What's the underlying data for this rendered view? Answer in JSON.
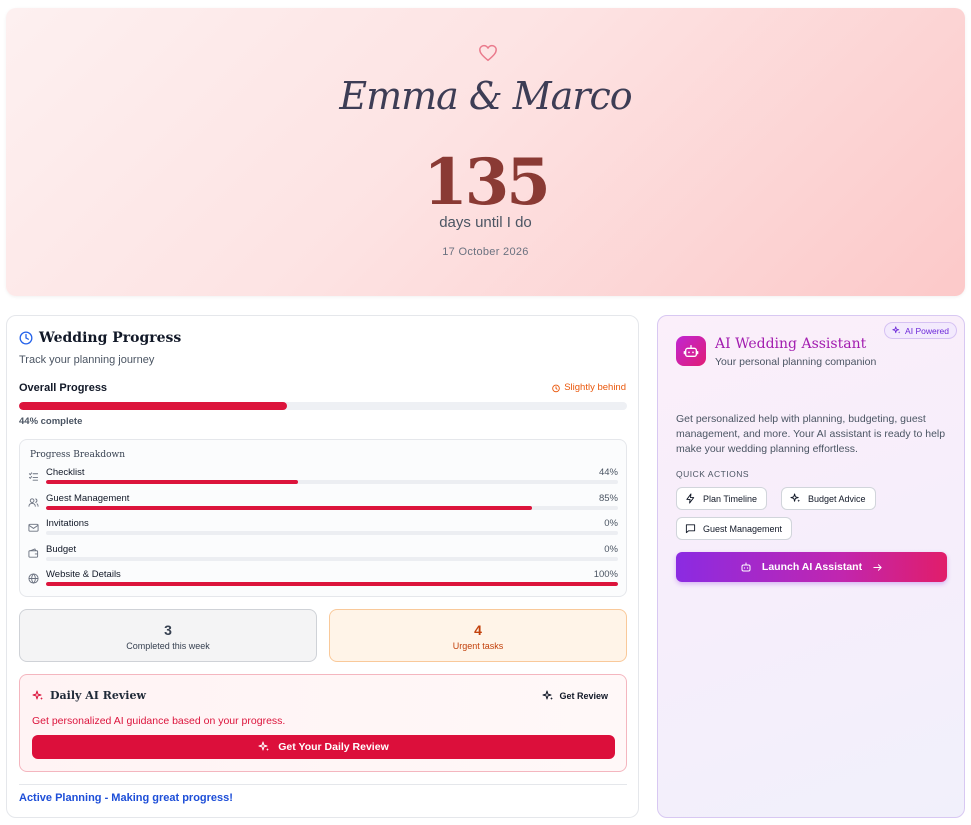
{
  "hero": {
    "couple_names": "Emma & Marco",
    "days_count": "135",
    "days_label": "days until I do",
    "wedding_date": "17 October 2026"
  },
  "progress": {
    "title": "Wedding Progress",
    "subtitle": "Track your planning journey",
    "overall_label": "Overall Progress",
    "status": "Slightly behind",
    "overall_percent": 44,
    "overall_percent_text": "44% complete",
    "breakdown_title": "Progress Breakdown",
    "breakdown": [
      {
        "label": "Checklist",
        "percent": 44,
        "percent_text": "44%",
        "icon": "checklist-icon"
      },
      {
        "label": "Guest Management",
        "percent": 85,
        "percent_text": "85%",
        "icon": "users-icon"
      },
      {
        "label": "Invitations",
        "percent": 0,
        "percent_text": "0%",
        "icon": "mail-icon"
      },
      {
        "label": "Budget",
        "percent": 0,
        "percent_text": "0%",
        "icon": "wallet-icon"
      },
      {
        "label": "Website & Details",
        "percent": 100,
        "percent_text": "100%",
        "icon": "globe-icon"
      }
    ],
    "completed_count": "3",
    "completed_label": "Completed this week",
    "urgent_count": "4",
    "urgent_label": "Urgent tasks",
    "daily_title": "Daily AI Review",
    "get_review_label": "Get Review",
    "daily_description": "Get personalized AI guidance based on your progress.",
    "daily_button_label": "Get Your Daily Review",
    "status_line": "Active Planning - Making great progress!"
  },
  "ai": {
    "badge": "AI Powered",
    "title": "AI Wedding Assistant",
    "subtitle": "Your personal planning companion",
    "description": "Get personalized help with planning, budgeting, guest management, and more. Your AI assistant is ready to help make your wedding planning effortless.",
    "quick_actions_label": "QUICK ACTIONS",
    "quick_actions": [
      "Plan Timeline",
      "Budget Advice",
      "Guest Management"
    ],
    "launch_label": "Launch AI Assistant"
  },
  "colors": {
    "accent": "#dc143c",
    "ai_purple": "#8b2be2",
    "ai_pink": "#e11d6a",
    "warning": "#ea580c",
    "link": "#1d4ed8"
  }
}
